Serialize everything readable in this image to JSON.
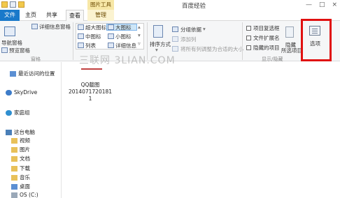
{
  "title_bar": {
    "context_tab_title": "图片工具",
    "window_title": "百度经验",
    "controls": [
      "—",
      "□",
      "×"
    ]
  },
  "tabs": {
    "file": "文件",
    "home": "主页",
    "share": "共享",
    "view": "查看",
    "manage": "管理"
  },
  "ribbon": {
    "panes": {
      "nav_pane": "导航窗格",
      "preview_pane": "预览窗格",
      "details_pane": "详细信息窗格",
      "group": "窗格"
    },
    "layout": {
      "extra_large": "超大图标",
      "large": "大图标",
      "medium": "中图标",
      "small": "小图标",
      "list": "列表",
      "details": "详细信息"
    },
    "current_view": {
      "sort_by": "排序方式",
      "group_by": "分组依据",
      "add_columns": "添加列",
      "size_all": "将所有列调整为合适的大小"
    },
    "show_hide": {
      "item_checkboxes": "项目复选框",
      "file_extensions": "文件扩展名",
      "hidden_items": "隐藏的项目",
      "hide_selected": "隐藏",
      "hide_selected_2": "所选项目",
      "group": "显示/隐藏"
    },
    "options": "选项"
  },
  "watermark": "三联网 3LIAN.COM",
  "nav": {
    "recent": "最近访问的位置",
    "skydrive": "SkyDrive",
    "homegroup": "家庭组",
    "this_pc": "这台电脑",
    "videos": "视频",
    "pictures": "图片",
    "documents": "文档",
    "downloads": "下载",
    "music": "音乐",
    "desktop": "桌面",
    "os": "OS (C:)"
  },
  "file": {
    "name_line1": "QQ截图",
    "name_line2": "2014071720181",
    "name_line3": "1"
  }
}
